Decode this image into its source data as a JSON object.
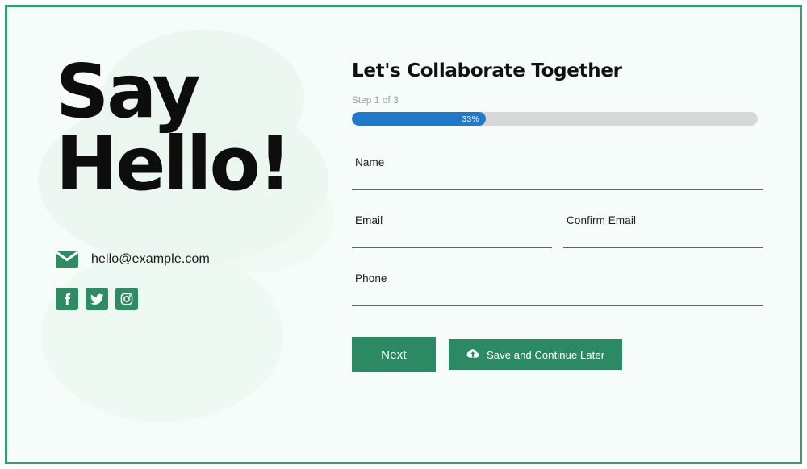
{
  "theme": {
    "frame_border": "#34a06c",
    "canvas_background": "#f6fcf9",
    "blob_color": "#e9f6ee",
    "brand_green": "#2e8b62",
    "button_green": "#2b8a63",
    "progress_blue": "#2079c8",
    "progress_track": "#d6d8da"
  },
  "left": {
    "hero_title": "Say\nHello!",
    "email": "hello@example.com",
    "mail_icon": "envelope-icon",
    "social": [
      {
        "name": "facebook",
        "icon": "facebook-icon",
        "label": "f"
      },
      {
        "name": "twitter",
        "icon": "twitter-icon",
        "label": ""
      },
      {
        "name": "instagram",
        "icon": "instagram-icon",
        "label": ""
      }
    ]
  },
  "form": {
    "heading": "Let's Collaborate Together",
    "step_label": "Step 1 of 3",
    "progress": {
      "value_label": "33%",
      "percent": 33
    },
    "fields": {
      "name": {
        "label": "Name",
        "value": "",
        "placeholder": ""
      },
      "email": {
        "label": "Email",
        "value": "",
        "placeholder": ""
      },
      "confirm_email": {
        "label": "Confirm Email",
        "value": "",
        "placeholder": ""
      },
      "phone": {
        "label": "Phone",
        "value": "",
        "placeholder": ""
      }
    },
    "actions": {
      "next_label": "Next",
      "save_later_label": "Save and Continue Later",
      "save_later_icon": "cloud-upload-icon"
    }
  }
}
